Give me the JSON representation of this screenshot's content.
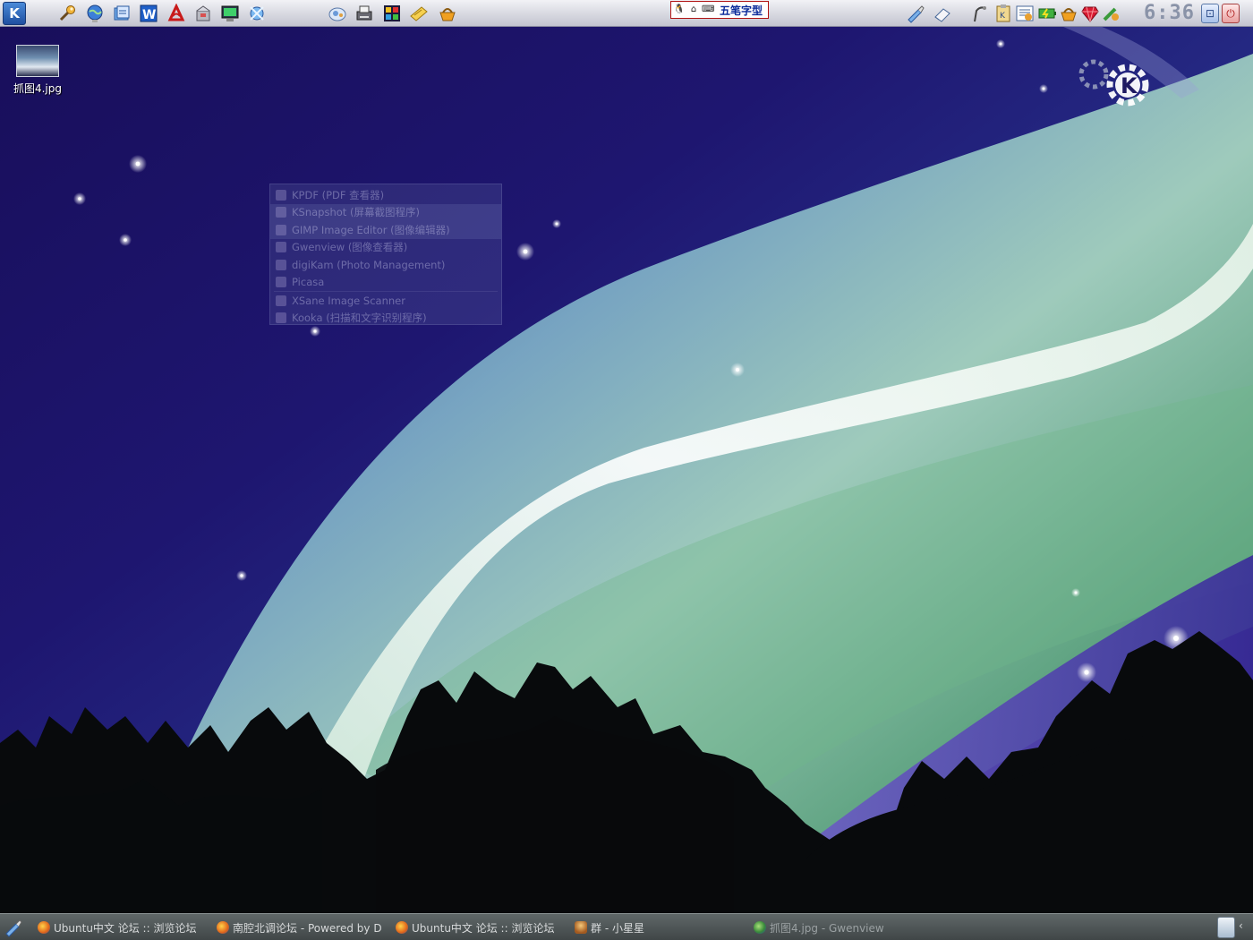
{
  "top_panel": {
    "kmenu_icon": "kde-k-menu-icon",
    "launchers_left": [
      {
        "name": "wrench-icon"
      },
      {
        "name": "konqueror-globe-icon"
      },
      {
        "name": "file-manager-icon"
      },
      {
        "name": "word-processor-icon"
      },
      {
        "name": "pdf-reader-icon"
      },
      {
        "name": "package-installer-icon"
      },
      {
        "name": "terminal-monitor-icon"
      },
      {
        "name": "network-tool-icon"
      }
    ],
    "launchers_mid": [
      {
        "name": "image-viewer-icon"
      },
      {
        "name": "scanner-printer-icon"
      },
      {
        "name": "paint-icon"
      },
      {
        "name": "note-icon"
      },
      {
        "name": "basket-icon"
      }
    ],
    "ime": {
      "cells": [
        "🐧",
        "⌂",
        "⌨"
      ],
      "name": "五笔字型"
    },
    "tray_right": [
      {
        "name": "klipper-brush-icon"
      },
      {
        "name": "eraser-icon"
      },
      {
        "name": "antenna-icon"
      },
      {
        "name": "klipboard-icon"
      },
      {
        "name": "notes-icon"
      },
      {
        "name": "battery-icon"
      },
      {
        "name": "basket-tray-icon"
      },
      {
        "name": "ruby-icon"
      },
      {
        "name": "kmix-icon"
      }
    ],
    "clock": "6:36",
    "lock_label": "⊡",
    "logout_label": "⏻"
  },
  "desktop": {
    "icon_label": "抓图4.jpg"
  },
  "fade_menu": {
    "items": [
      {
        "label": "KPDF (PDF 查看器)",
        "icon": "kpdf-icon"
      },
      {
        "label": "KSnapshot (屏幕截图程序)",
        "icon": "ksnapshot-icon"
      },
      {
        "label": "GIMP Image Editor (图像编辑器)",
        "icon": "gimp-icon"
      },
      {
        "label": "Gwenview (图像查看器)",
        "icon": "gwenview-icon"
      },
      {
        "label": "digiKam (Photo Management)",
        "icon": "digikam-icon"
      },
      {
        "label": "Picasa",
        "icon": "picasa-icon"
      },
      {
        "label": "XSane Image Scanner",
        "icon": "xsane-icon"
      },
      {
        "label": "Kooka (扫描和文字识别程序)",
        "icon": "kooka-icon"
      }
    ]
  },
  "taskbar": {
    "tasks": [
      {
        "label": "Ubuntu中文 论坛 :: 浏览论坛",
        "icon": "firefox-icon",
        "kind": "ff"
      },
      {
        "label": "南腔北调论坛 - Powered by D",
        "icon": "firefox-icon",
        "kind": "ff"
      },
      {
        "label": "Ubuntu中文 论坛 :: 浏览论坛",
        "icon": "firefox-icon",
        "kind": "ff"
      },
      {
        "label": "群 - 小星星",
        "icon": "qq-icon",
        "kind": "qq"
      },
      {
        "label": "抓图4.jpg - Gwenview",
        "icon": "gwenview-icon",
        "kind": "gv"
      }
    ],
    "tray_arrow": "‹"
  }
}
